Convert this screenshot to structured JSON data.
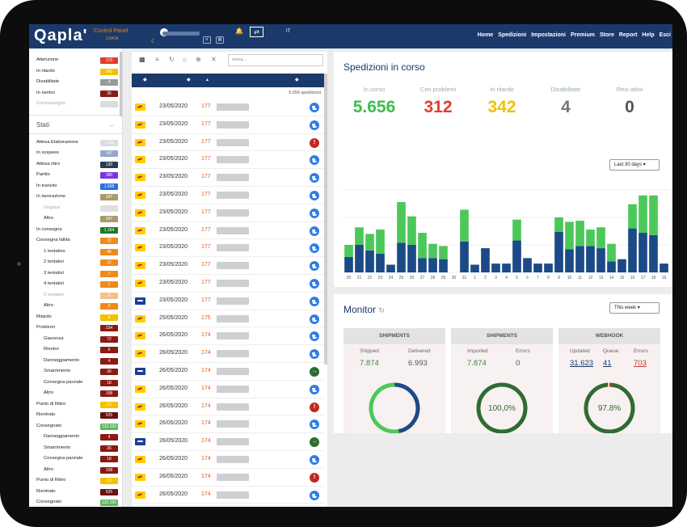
{
  "topbar": {
    "logo": "Qapla'",
    "control_panel": "Control Panel",
    "version": "2.64.0r",
    "lang": "IT",
    "nav": [
      "Home",
      "Spedizioni",
      "Impostazioni",
      "Premium",
      "Store",
      "Report",
      "Help",
      "Esci"
    ]
  },
  "sidebar": {
    "alerts": [
      {
        "label": "Attenzione",
        "count": "170",
        "color": "#e23b2e",
        "muted": false
      },
      {
        "label": "In ritardo",
        "count": "342",
        "color": "#f2c200",
        "muted": false
      },
      {
        "label": "Disabilitate",
        "count": "4",
        "color": "#9a9a9a",
        "muted": false
      },
      {
        "label": "In rientro",
        "count": "35",
        "color": "#8b1a12",
        "muted": false
      },
      {
        "label": "Contrassegno",
        "count": "",
        "color": "#dcdcdc",
        "muted": true
      }
    ],
    "stati_label": "Stati",
    "states": [
      {
        "label": "Attesa Elaborazione",
        "count": "1.206",
        "color": "#d8dde5",
        "indent": false,
        "muted": false
      },
      {
        "label": "In sospeso",
        "count": "147",
        "color": "#93a8c7",
        "indent": false,
        "muted": false
      },
      {
        "label": "Attesa ritiro",
        "count": "130",
        "color": "#2d3b55",
        "indent": false,
        "muted": false
      },
      {
        "label": "Partito",
        "count": "380",
        "color": "#7b35d9",
        "indent": false,
        "muted": false
      },
      {
        "label": "In transito",
        "count": "1.938",
        "color": "#2b6fe0",
        "indent": false,
        "muted": false
      },
      {
        "label": "In lavorazione",
        "count": "347",
        "color": "#a89a6a",
        "indent": false,
        "muted": false
      },
      {
        "label": "Dogana",
        "count": "",
        "color": "#e0e0e0",
        "indent": true,
        "muted": true
      },
      {
        "label": "Altro",
        "count": "347",
        "color": "#a89a6a",
        "indent": true,
        "muted": false
      },
      {
        "label": "In consegna",
        "count": "1.164",
        "color": "#1e7a2a",
        "indent": false,
        "muted": false
      },
      {
        "label": "Consegna fallita",
        "count": "72",
        "color": "#f08a1c",
        "indent": false,
        "muted": false
      },
      {
        "label": "1 tentativo",
        "count": "46",
        "color": "#f08a1c",
        "indent": true,
        "muted": false
      },
      {
        "label": "2 tentativi",
        "count": "12",
        "color": "#f08a1c",
        "indent": true,
        "muted": false
      },
      {
        "label": "3 tentativi",
        "count": "7",
        "color": "#f08a1c",
        "indent": true,
        "muted": false
      },
      {
        "label": "4 tentativi",
        "count": "1",
        "color": "#f08a1c",
        "indent": true,
        "muted": false
      },
      {
        "label": "5 tentativi",
        "count": "0",
        "color": "#f5c08a",
        "indent": true,
        "muted": true
      },
      {
        "label": "Altro",
        "count": "2",
        "color": "#f08a1c",
        "indent": true,
        "muted": false
      },
      {
        "label": "Ritardo",
        "count": "8",
        "color": "#f2c200",
        "indent": false,
        "muted": false
      },
      {
        "label": "Problemi",
        "count": "234",
        "color": "#8b1a12",
        "indent": false,
        "muted": false
      },
      {
        "label": "Giacenza",
        "count": "72",
        "color": "#8b1a12",
        "indent": true,
        "muted": false
      },
      {
        "label": "Rientro",
        "count": "6",
        "color": "#8b1a12",
        "indent": true,
        "muted": false
      },
      {
        "label": "Danneggiamento",
        "count": "4",
        "color": "#8b1a12",
        "indent": true,
        "muted": false
      },
      {
        "label": "Smarrimento",
        "count": "26",
        "color": "#8b1a12",
        "indent": true,
        "muted": false
      },
      {
        "label": "Consegna parziale",
        "count": "18",
        "color": "#8b1a12",
        "indent": true,
        "muted": false
      },
      {
        "label": "Altro",
        "count": "108",
        "color": "#8b1a12",
        "indent": true,
        "muted": false
      },
      {
        "label": "Punto di Ritiro",
        "count": "10",
        "color": "#f2c200",
        "indent": false,
        "muted": false
      },
      {
        "label": "Rientrato",
        "count": "525",
        "color": "#6b1010",
        "indent": false,
        "muted": false
      },
      {
        "label": "Consegnato",
        "count": "132.250",
        "color": "#5cb85c",
        "indent": false,
        "muted": false
      },
      {
        "label": "Danneggiamento",
        "count": "4",
        "color": "#8b1a12",
        "indent": true,
        "muted": false
      },
      {
        "label": "Smarrimento",
        "count": "26",
        "color": "#8b1a12",
        "indent": true,
        "muted": false
      },
      {
        "label": "Consegna parziale",
        "count": "18",
        "color": "#8b1a12",
        "indent": true,
        "muted": false
      },
      {
        "label": "Altro",
        "count": "108",
        "color": "#8b1a12",
        "indent": true,
        "muted": false
      },
      {
        "label": "Punto di Ritiro",
        "count": "10",
        "color": "#f2c200",
        "indent": false,
        "muted": false
      },
      {
        "label": "Rientrato",
        "count": "525",
        "color": "#6b1010",
        "indent": false,
        "muted": false
      },
      {
        "label": "Consegnato",
        "count": "132.250",
        "color": "#5cb85c",
        "indent": false,
        "muted": false
      }
    ]
  },
  "list": {
    "search_placeholder": "cerca...",
    "count": "5.656 spedizioni",
    "rows": [
      {
        "carrier": "yellow",
        "date": "23/05/2020",
        "code": "177",
        "status": "blue"
      },
      {
        "carrier": "yellow",
        "date": "23/05/2020",
        "code": "177",
        "status": "blue"
      },
      {
        "carrier": "yellow",
        "date": "23/05/2020",
        "code": "177",
        "status": "red"
      },
      {
        "carrier": "yellow",
        "date": "23/05/2020",
        "code": "177",
        "status": "blue"
      },
      {
        "carrier": "yellow",
        "date": "23/05/2020",
        "code": "177",
        "status": "blue"
      },
      {
        "carrier": "yellow",
        "date": "23/05/2020",
        "code": "177",
        "status": "blue"
      },
      {
        "carrier": "yellow",
        "date": "23/05/2020",
        "code": "177",
        "status": "blue"
      },
      {
        "carrier": "yellow",
        "date": "23/05/2020",
        "code": "177",
        "status": "blue"
      },
      {
        "carrier": "yellow",
        "date": "23/05/2020",
        "code": "177",
        "status": "blue"
      },
      {
        "carrier": "yellow",
        "date": "23/05/2020",
        "code": "177",
        "status": "blue"
      },
      {
        "carrier": "yellow",
        "date": "23/05/2020",
        "code": "177",
        "status": "blue"
      },
      {
        "carrier": "blue",
        "date": "23/05/2020",
        "code": "177",
        "status": "blue"
      },
      {
        "carrier": "yellow",
        "date": "25/05/2020",
        "code": "175",
        "status": "blue"
      },
      {
        "carrier": "yellow",
        "date": "26/05/2020",
        "code": "174",
        "status": "blue"
      },
      {
        "carrier": "yellow",
        "date": "26/05/2020",
        "code": "174",
        "status": "blue"
      },
      {
        "carrier": "blue",
        "date": "26/05/2020",
        "code": "174",
        "status": "green"
      },
      {
        "carrier": "yellow",
        "date": "26/05/2020",
        "code": "174",
        "status": "blue"
      },
      {
        "carrier": "yellow",
        "date": "26/05/2020",
        "code": "174",
        "status": "red"
      },
      {
        "carrier": "yellow",
        "date": "26/05/2020",
        "code": "174",
        "status": "blue"
      },
      {
        "carrier": "blue",
        "date": "26/05/2020",
        "code": "174",
        "status": "green"
      },
      {
        "carrier": "yellow",
        "date": "26/05/2020",
        "code": "174",
        "status": "blue"
      },
      {
        "carrier": "yellow",
        "date": "26/05/2020",
        "code": "174",
        "status": "red"
      },
      {
        "carrier": "yellow",
        "date": "26/05/2020",
        "code": "174",
        "status": "blue"
      }
    ]
  },
  "shipments_panel": {
    "title": "Spedizioni in corso",
    "stats": [
      {
        "label": "In corso",
        "value": "5.656",
        "color": "#3cbf4a"
      },
      {
        "label": "Con problemi",
        "value": "312",
        "color": "#e23b2e"
      },
      {
        "label": "In ritardo",
        "value": "342",
        "color": "#f2c200"
      },
      {
        "label": "Disabilitate",
        "value": "4",
        "color": "#777777"
      },
      {
        "label": "Resi attivi",
        "value": "0",
        "color": "#555555"
      }
    ],
    "range": "Last 30 days"
  },
  "chart_data": {
    "type": "bar",
    "stacked": true,
    "categories": [
      "20",
      "21",
      "22",
      "23",
      "24",
      "25",
      "26",
      "27",
      "28",
      "29",
      "30",
      "31",
      "1",
      "2",
      "3",
      "4",
      "5",
      "6",
      "7",
      "8",
      "9",
      "10",
      "11",
      "12",
      "13",
      "14",
      "15",
      "16",
      "17",
      "18",
      "19"
    ],
    "series": [
      {
        "color": "#1b4a86",
        "values": [
          14,
          25,
          20,
          17,
          7,
          27,
          25,
          13,
          13,
          12,
          0,
          28,
          7,
          22,
          8,
          8,
          29,
          13,
          8,
          8,
          37,
          21,
          24,
          24,
          22,
          10,
          12,
          40,
          36,
          34,
          8
        ]
      },
      {
        "color": "#4cc85a",
        "values": [
          11,
          16,
          15,
          22,
          0,
          37,
          26,
          23,
          13,
          12,
          0,
          29,
          0,
          0,
          0,
          0,
          19,
          0,
          0,
          0,
          13,
          25,
          23,
          15,
          19,
          16,
          0,
          22,
          34,
          36,
          0
        ]
      }
    ]
  },
  "monitor": {
    "title": "Monitor",
    "range": "This week",
    "cards": [
      {
        "header": "SHIPMENTS",
        "l1": "Shipped",
        "l2": "Delivered",
        "v1": "7.874",
        "v2": "6.993",
        "center": ""
      },
      {
        "header": "SHIPMENTS",
        "l1": "Imported",
        "l2": "Errors",
        "v1": "7.874",
        "v2": "0",
        "center": "100,0%"
      },
      {
        "header": "WEBHOOK",
        "l1": "Updated",
        "l2": "Queue",
        "l3": "Errors",
        "v1": "31.623",
        "v2": "41",
        "v3": "703",
        "center": "97.8%"
      }
    ]
  }
}
